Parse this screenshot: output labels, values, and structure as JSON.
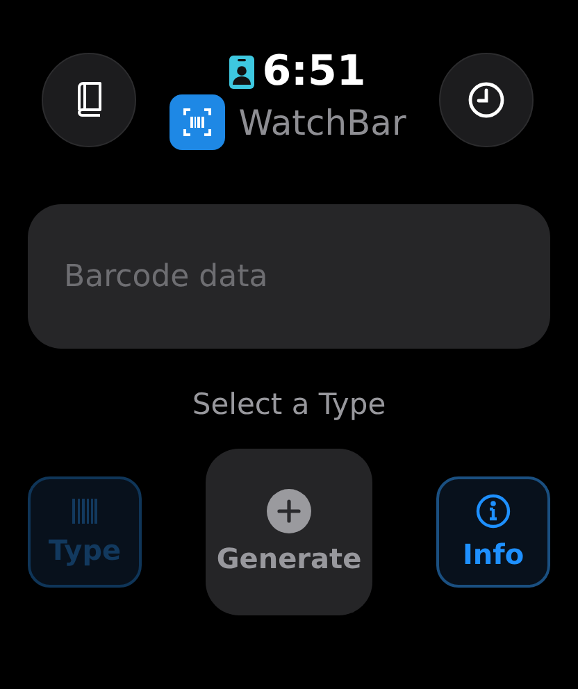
{
  "status": {
    "time": "6:51"
  },
  "app": {
    "name": "WatchBar"
  },
  "field": {
    "placeholder": "Barcode data"
  },
  "prompt": "Select a Type",
  "buttons": [
    {
      "kind": "type",
      "label": "Type",
      "disabled": true
    },
    {
      "kind": "generate",
      "label": "Generate",
      "disabled": true
    },
    {
      "kind": "info",
      "label": "Info",
      "disabled": false
    }
  ]
}
